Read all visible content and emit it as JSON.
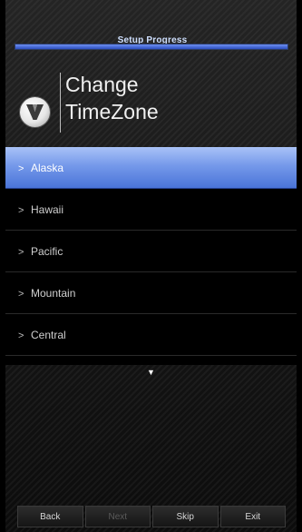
{
  "progress": {
    "title": "Setup Progress",
    "fraction": 1.0
  },
  "header": {
    "title_line1": "Change",
    "title_line2": "TimeZone"
  },
  "timezones": [
    "Alaska",
    "Hawaii",
    "Pacific",
    "Mountain",
    "Central"
  ],
  "selected_index": 0,
  "footer": {
    "back_label": "Back",
    "next_label": "Next",
    "skip_label": "Skip",
    "exit_label": "Exit"
  },
  "icons": {
    "logo": "vizio-v-logo",
    "list_chevron": "chevron-right-icon",
    "more": "chevron-down-icon"
  },
  "colors": {
    "selected_accent": "#5a80df",
    "progress_fill": "#4d6fe0"
  }
}
